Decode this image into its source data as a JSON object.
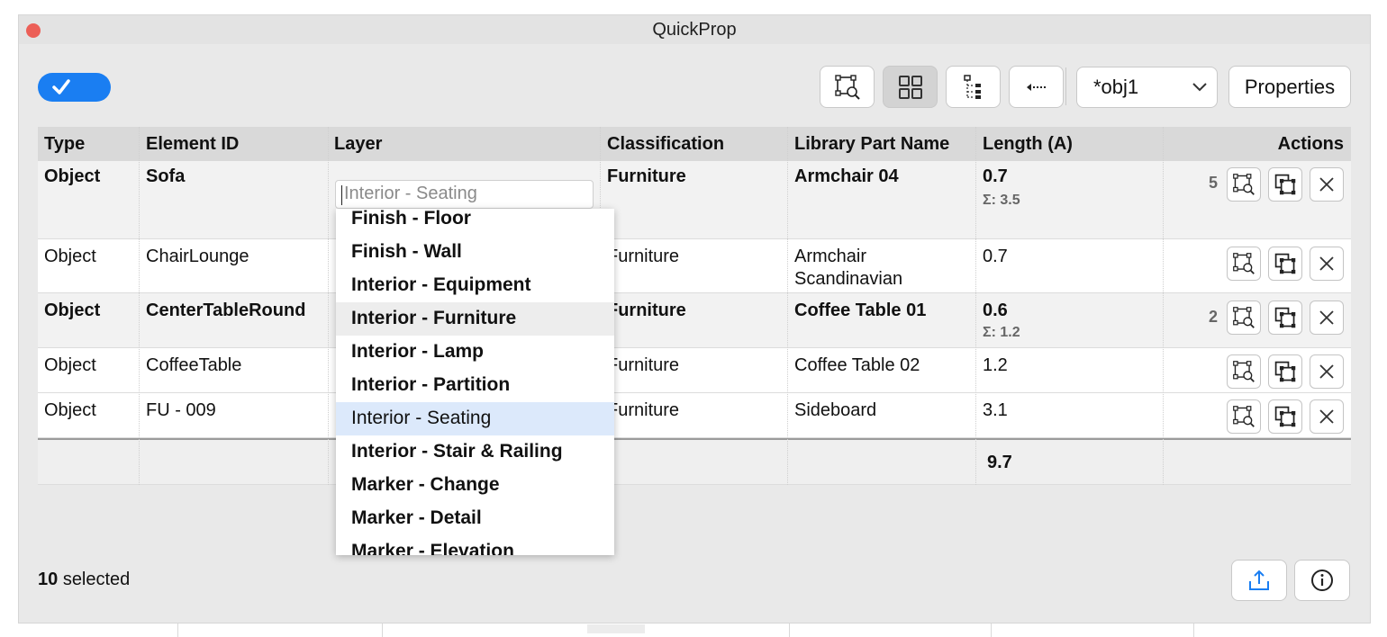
{
  "window": {
    "title": "QuickProp"
  },
  "toolbar": {
    "toggle_checked": true,
    "buttons": [
      {
        "icon": "zoom-to-selection-icon"
      },
      {
        "icon": "grid-view-icon",
        "active": true
      },
      {
        "icon": "tree-view-icon"
      },
      {
        "icon": "arrow-left-dotted-icon"
      }
    ],
    "view_select": "*obj1",
    "properties_label": "Properties"
  },
  "table": {
    "headers": [
      "Type",
      "Element ID",
      "Layer",
      "Classification",
      "Library Part Name",
      "Length (A)",
      "Actions"
    ],
    "rows": [
      {
        "type": "Object",
        "element_id": "Sofa",
        "layer": "Interior - Seating",
        "classification": "Furniture",
        "library_part": "Armchair 04",
        "length": "0.7",
        "sum": "Σ: 3.5",
        "count": "5",
        "bold": true
      },
      {
        "type": "Object",
        "element_id": "ChairLounge",
        "layer": "",
        "classification": "Furniture",
        "library_part_1": "Armchair",
        "library_part_2": "Scandinavian",
        "length": "0.7",
        "bold": false
      },
      {
        "type": "Object",
        "element_id": "CenterTableRound",
        "layer": "",
        "classification": "Furniture",
        "library_part": "Coffee Table 01",
        "length": "0.6",
        "sum": "Σ: 1.2",
        "count": "2",
        "bold": true
      },
      {
        "type": "Object",
        "element_id": "CoffeeTable",
        "layer": "",
        "classification": "Furniture",
        "library_part": "Coffee Table 02",
        "length": "1.2",
        "bold": false
      },
      {
        "type": "Object",
        "element_id": "FU - 009",
        "layer": "",
        "classification": "Furniture",
        "library_part": "Sideboard",
        "length": "3.1",
        "bold": false
      }
    ],
    "total_length": "9.7"
  },
  "layer_input": {
    "value": "Interior - Seating"
  },
  "layer_dropdown": {
    "options": [
      "Finish - Floor",
      "Finish - Wall",
      "Interior - Equipment",
      "Interior - Furniture",
      "Interior - Lamp",
      "Interior - Partition",
      "Interior - Seating",
      "Interior - Stair & Railing",
      "Marker - Change",
      "Marker - Detail",
      "Marker - Elevation"
    ],
    "hovered": "Interior - Furniture",
    "selected": "Interior - Seating"
  },
  "footer": {
    "selected_count": "10",
    "selected_label": "selected",
    "export_icon": "share-icon",
    "info_icon": "info-icon"
  },
  "colors": {
    "accent": "#1a7ef2",
    "selection": "#dce9fb",
    "close": "#ec5f57"
  }
}
